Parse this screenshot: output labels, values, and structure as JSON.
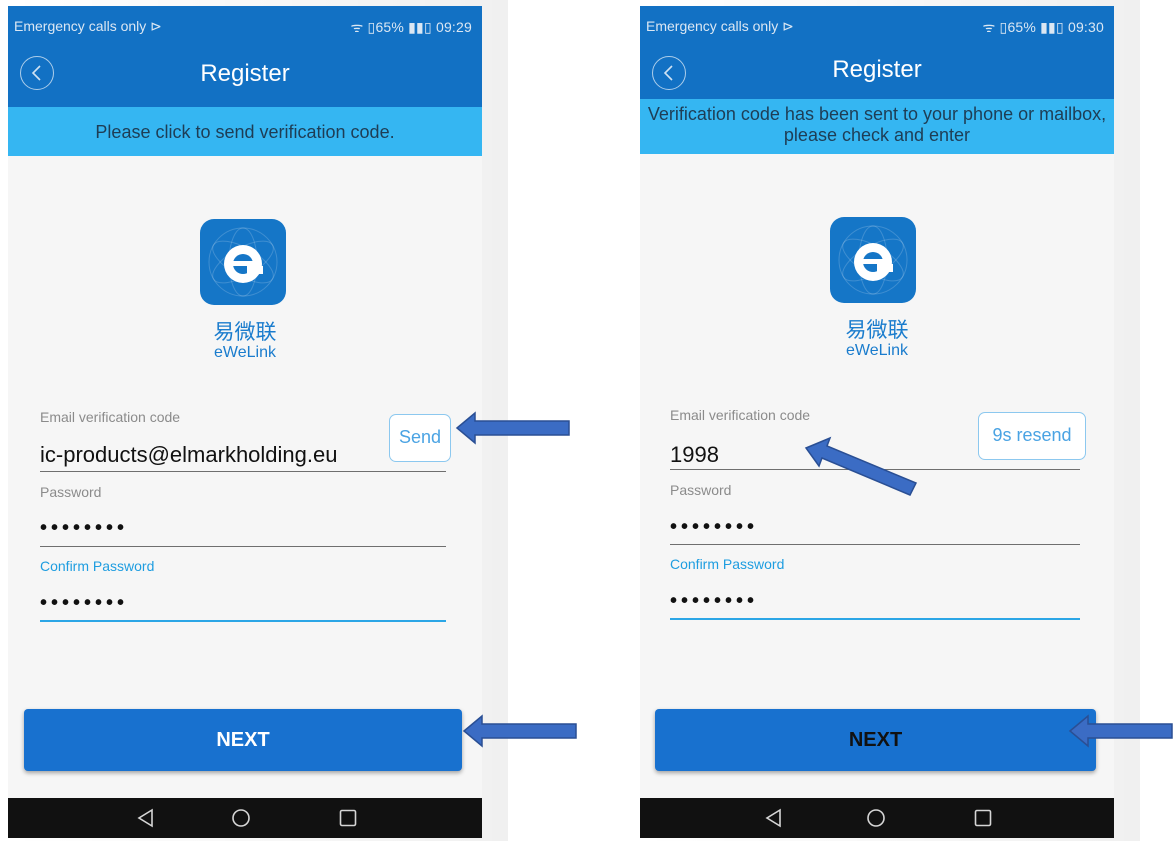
{
  "left": {
    "status_left": "Emergency calls only ⊳",
    "status_right": "ᯤ ▯65% ▮▮▯ 09:29",
    "title": "Register",
    "hint": "Please click to send verification code.",
    "logo_cn": "易微联",
    "logo_en": "eWeLink",
    "email_label": "Email verification code",
    "email_value": "ic-products@elmarkholding.eu",
    "send_label": "Send",
    "password_label": "Password",
    "password_value": "••••••••",
    "confirm_label": "Confirm Password",
    "confirm_value": "••••••••",
    "next_label": "NEXT"
  },
  "right": {
    "status_left": "Emergency calls only ⊳",
    "status_right": "ᯤ ▯65% ▮▮▯ 09:30",
    "title": "Register",
    "hint": "Verification code has been sent to your phone or mailbox, please check and enter",
    "logo_cn": "易微联",
    "logo_en": "eWeLink",
    "email_label": "Email verification code",
    "email_value": "1998",
    "resend_label": "9s resend",
    "password_label": "Password",
    "password_value": "••••••••",
    "confirm_label": "Confirm Password",
    "confirm_value": "••••••••",
    "next_label": "NEXT"
  },
  "colors": {
    "app_bar": "#1271c4",
    "hint_bar": "#35b6f2",
    "accent": "#2ba6e6",
    "next_button": "#1871cf",
    "annotation_arrow": "#3b6cc4"
  },
  "icons": [
    "back-icon",
    "ewelink-logo-icon",
    "nav-back-icon",
    "nav-home-icon",
    "nav-recents-icon",
    "annotation-arrow"
  ]
}
